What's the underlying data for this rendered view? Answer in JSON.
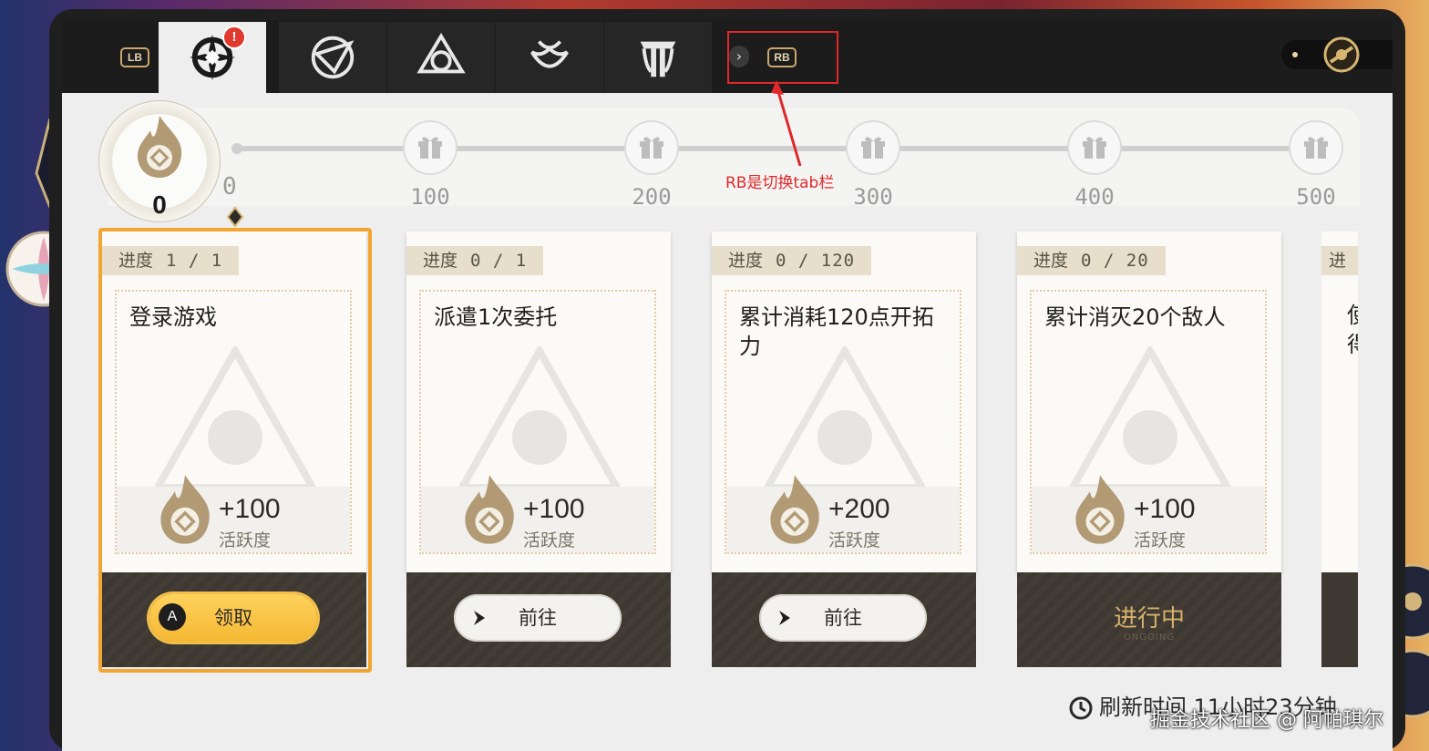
{
  "header": {
    "lb_label": "LB",
    "rb_label": "RB",
    "alert_badge": "!",
    "tabs": [
      {
        "icon": "daily-training-icon",
        "active": true
      },
      {
        "icon": "compass-triangle-icon",
        "active": false
      },
      {
        "icon": "tri-emblem-icon",
        "active": false
      },
      {
        "icon": "shell-emblem-icon",
        "active": false
      },
      {
        "icon": "pillar-emblem-icon",
        "active": false
      }
    ]
  },
  "annotation": {
    "text": "RB是切换tab栏"
  },
  "points": {
    "current": "0",
    "milestones": [
      "0",
      "100",
      "200",
      "300",
      "400",
      "500"
    ]
  },
  "cards": [
    {
      "progress_label": "进度",
      "progress_value": "1 / 1",
      "title": "登录游戏",
      "reward": "+100",
      "reward_label": "活跃度",
      "action": "领取",
      "action_key": "A",
      "state": "claim"
    },
    {
      "progress_label": "进度",
      "progress_value": "0 / 1",
      "title": "派遣1次委托",
      "reward": "+100",
      "reward_label": "活跃度",
      "action": "前往",
      "state": "goto"
    },
    {
      "progress_label": "进度",
      "progress_value": "0 / 120",
      "title": "累计消耗120点开拓力",
      "reward": "+200",
      "reward_label": "活跃度",
      "action": "前往",
      "state": "goto"
    },
    {
      "progress_label": "进度",
      "progress_value": "0 / 20",
      "title": "累计消灭20个敌人",
      "reward": "+100",
      "reward_label": "活跃度",
      "action": "进行中",
      "action_sub": "ONGOING",
      "state": "in-progress"
    }
  ],
  "edge_card": {
    "tag": "进",
    "title": "使得"
  },
  "footer": {
    "refresh_text": "刷新时间 11小时23分钟",
    "watermark": "掘金技术社区 @ 阿帕琪尔"
  },
  "colors": {
    "accent_gold": "#f2a530",
    "claim_yellow": "#f4b833",
    "annotation_red": "#e0282a"
  }
}
